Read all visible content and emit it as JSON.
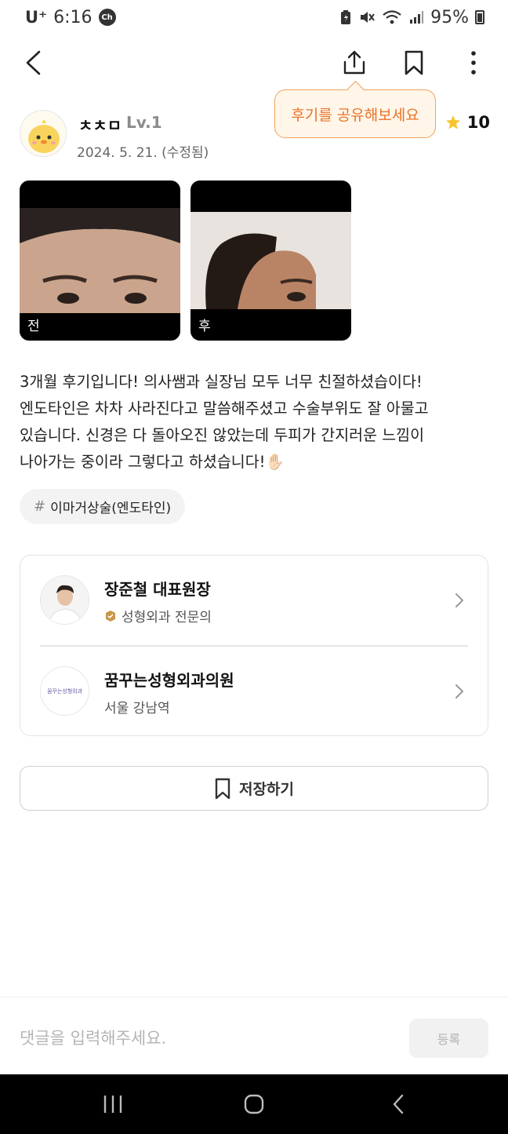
{
  "status_bar": {
    "carrier": "U⁺",
    "time": "6:16",
    "notification": "Ch",
    "battery": "95%"
  },
  "nav": {
    "icons": [
      "back-icon",
      "share-icon",
      "bookmark-icon",
      "more-icon"
    ]
  },
  "tooltip": "후기를 공유해보세요",
  "author": {
    "name": "ㅊㅊㅁ",
    "level": "Lv.1",
    "date": "2024. 5. 21. (수정됨)"
  },
  "rating": {
    "value": "10"
  },
  "photos": [
    {
      "label": "전"
    },
    {
      "label": "후"
    }
  ],
  "review": {
    "lines": [
      "3개월 후기입니다! 의사쌤과 실장님 모두 너무 친절하셨습이다!",
      "엔도타인은 차차 사라진다고 말씀해주셨고 수술부위도 잘 아물고",
      "있습니다. 신경은 다 돌아오진 않았는데 두피가 간지러운 느낌이",
      "나아가는 중이라 그렇다고 하셨습니다!✋🏻"
    ]
  },
  "tag": {
    "hash": "#",
    "label": "이마거상술(엔도타인)"
  },
  "doctor": {
    "name": "장준철 대표원장",
    "specialty": "성형외과 전문의"
  },
  "clinic": {
    "name": "꿈꾸는성형외과의원",
    "location": "서울 강남역",
    "logo_text": "꿈꾸는성형외과"
  },
  "save_button": {
    "label": "저장하기"
  },
  "comment": {
    "placeholder": "댓글을 입력해주세요.",
    "submit_label": "등록"
  },
  "colors": {
    "accent_orange": "#e8732a",
    "tooltip_bg": "#fff6e9",
    "star": "#f7c531",
    "badge": "#c9964a"
  }
}
